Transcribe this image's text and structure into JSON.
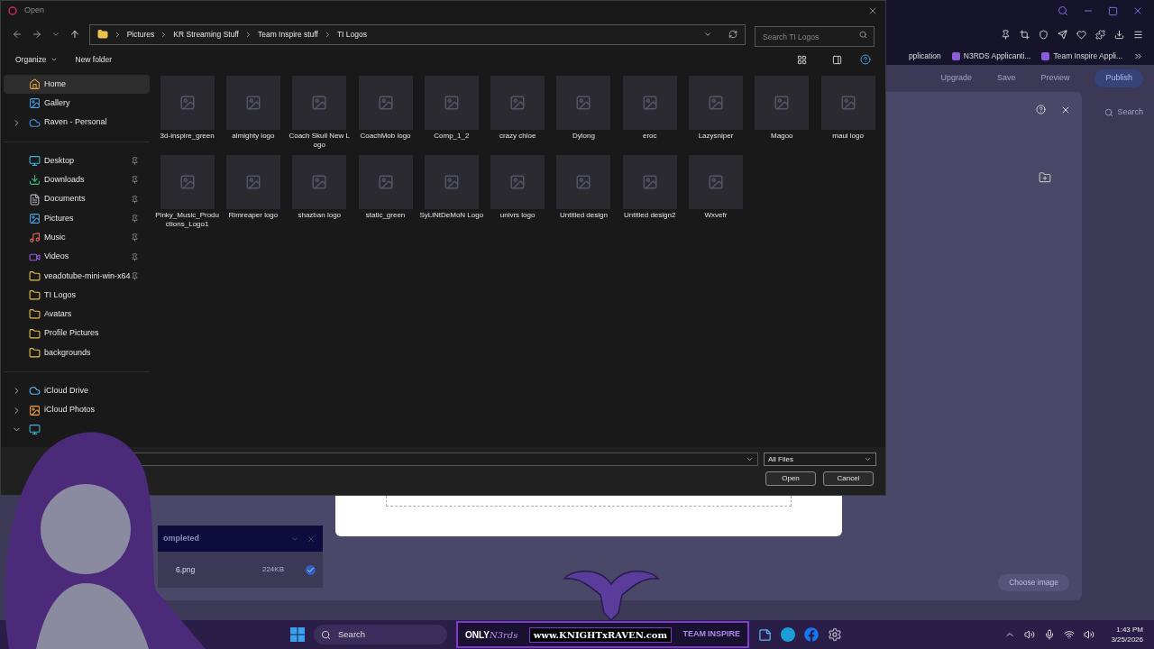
{
  "dialog": {
    "title": "Open",
    "breadcrumb": [
      "Pictures",
      "KR Streaming Stuff",
      "Team Inspire stuff",
      "TI Logos"
    ],
    "search": {
      "placeholder": "Search TI Logos"
    },
    "toolbar": [
      {
        "label": "Organize",
        "kind": "menu"
      },
      {
        "label": "New folder",
        "kind": "button"
      }
    ],
    "sidebar": [
      [
        {
          "label": "Home",
          "kind": "home",
          "pinned": false,
          "selected": true
        },
        {
          "label": "Gallery",
          "kind": "gallery",
          "pinned": false,
          "selected": false
        },
        {
          "label": "Raven - Personal",
          "kind": "cloud",
          "expanded": false,
          "pinned": false,
          "selected": false
        }
      ],
      [
        {
          "label": "Desktop",
          "kind": "desktop",
          "pinned": true,
          "selected": false
        },
        {
          "label": "Downloads",
          "kind": "download",
          "pinned": true,
          "selected": false
        },
        {
          "label": "Documents",
          "kind": "documents",
          "pinned": true,
          "selected": false
        },
        {
          "label": "Pictures",
          "kind": "pictures",
          "pinned": true,
          "selected": false
        },
        {
          "label": "Music",
          "kind": "music",
          "pinned": true,
          "selected": false
        },
        {
          "label": "Videos",
          "kind": "videos",
          "pinned": true,
          "selected": false
        },
        {
          "label": "veadotube-mini-win-x64",
          "kind": "folder",
          "pinned": true,
          "selected": false
        },
        {
          "label": "TI Logos",
          "kind": "folder",
          "pinned": false,
          "selected": false
        },
        {
          "label": "Avatars",
          "kind": "folder",
          "pinned": false,
          "selected": false
        },
        {
          "label": "Profile Pictures",
          "kind": "folder",
          "pinned": false,
          "selected": false
        },
        {
          "label": "backgrounds",
          "kind": "folder",
          "pinned": false,
          "selected": false
        }
      ],
      [
        {
          "label": "iCloud Drive",
          "kind": "icloud",
          "expanded": false,
          "pinned": false,
          "selected": false
        },
        {
          "label": "iCloud Photos",
          "kind": "photos",
          "expanded": false,
          "pinned": false,
          "selected": false
        },
        {
          "kind": "desktop",
          "expanded": true,
          "pinned": false,
          "selected": false
        }
      ]
    ],
    "files": [
      {
        "name": "3d-inspire_green"
      },
      {
        "name": "almighty logo"
      },
      {
        "name": "Coach Skull New Logo"
      },
      {
        "name": "CoachMob logo"
      },
      {
        "name": "Comp_1_2"
      },
      {
        "name": "crazy chloe"
      },
      {
        "name": "Dylong"
      },
      {
        "name": "eroc"
      },
      {
        "name": "Lazysniper"
      },
      {
        "name": "Magoo"
      },
      {
        "name": "maui logo"
      },
      {
        "name": "Pinky_Music_Productions_Logo1"
      },
      {
        "name": "Rimreaper logo"
      },
      {
        "name": "shazban logo"
      },
      {
        "name": "static_green"
      },
      {
        "name": "SyLiNtDeMoN Logo"
      },
      {
        "name": "univrs logo"
      },
      {
        "name": "Untitled design"
      },
      {
        "name": "Untitled design2"
      },
      {
        "name": "Wxvefr"
      }
    ],
    "file_type": "All Files",
    "buttons": [
      "Open",
      "Cancel"
    ]
  },
  "browser": {
    "bookmarks": [
      "pplication",
      "N3RDS Applicanti...",
      "Team Inspire Appli..."
    ],
    "header_buttons": [
      "Upgrade",
      "Save",
      "Preview",
      "Publish"
    ],
    "search_label": "Search",
    "upload": {
      "status": "ompleted",
      "file": "6.png",
      "size": "224KB",
      "button": "Choose image"
    }
  },
  "taskbar": {
    "search": "Search",
    "banner": {
      "left": [
        "ONLY",
        "N3rds"
      ],
      "center": "www.KNIGHTxRAVEN.com",
      "right": [
        "TEAM",
        "INSPIRE"
      ]
    },
    "time": "1:43 PM",
    "date": "3/25/2026"
  }
}
